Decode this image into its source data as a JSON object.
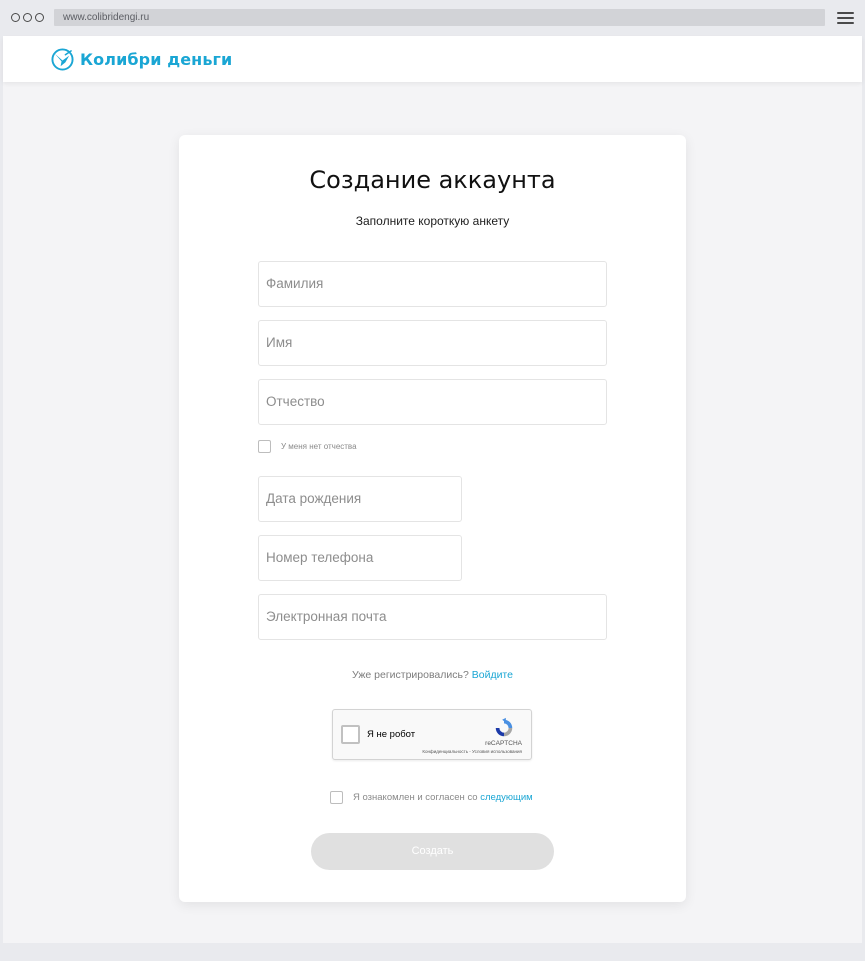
{
  "browser": {
    "url": "www.colibridengi.ru"
  },
  "header": {
    "brand": "Колибри деньги",
    "brand_color": "#1aa6d4"
  },
  "form": {
    "title": "Создание аккаунта",
    "subtitle": "Заполните короткую анкету",
    "fields": {
      "surname": "Фамилия",
      "name": "Имя",
      "patronymic": "Отчество",
      "birth_date": "Дата рождения",
      "phone": "Номер телефона",
      "email": "Электронная почта"
    },
    "no_patronymic_label": "У меня нет отчества",
    "already_registered": "Уже регистрировались?",
    "login_link": "Войдите",
    "recaptcha": {
      "label": "Я не робот",
      "brand": "reCAPTCHA",
      "terms": "Конфиденциальность - Условия использования"
    },
    "agree_text": "Я ознакомлен и согласен со",
    "agree_link": "следующим",
    "submit_label": "Создать"
  },
  "icons": {
    "logo": "hummingbird-icon",
    "menu": "hamburger-menu-icon",
    "captcha": "recaptcha-icon"
  }
}
